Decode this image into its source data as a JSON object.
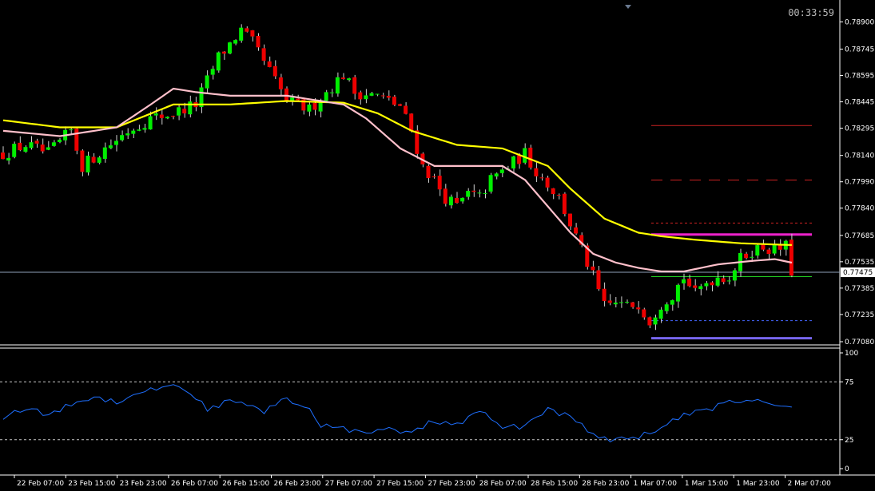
{
  "timer": "00:33:59",
  "colors": {
    "background": "#000000",
    "bull": "#00ee00",
    "bear": "#ee0000",
    "ema_slow": "#ffff00",
    "ema_fast": "#ffc0cb",
    "rsi": "#1e6fff",
    "axis": "#ffffff"
  },
  "chart_data": [
    {
      "type": "candlestick",
      "ylim": [
        0.7708,
        0.7897
      ],
      "y_ticks": [
        "0.78900",
        "0.78745",
        "0.78595",
        "0.78445",
        "0.78295",
        "0.78140",
        "0.77990",
        "0.77840",
        "0.77685",
        "0.77535",
        "0.77385",
        "0.77235",
        "0.77080"
      ],
      "current_price": "0.77475",
      "x_labels": [
        "22 Feb 07:00",
        "23 Feb 15:00",
        "23 Feb 23:00",
        "26 Feb 07:00",
        "26 Feb 15:00",
        "26 Feb 23:00",
        "27 Feb 07:00",
        "27 Feb 15:00",
        "27 Feb 23:00",
        "28 Feb 07:00",
        "28 Feb 15:00",
        "28 Feb 23:00",
        "1 Mar 07:00",
        "1 Mar 15:00",
        "1 Mar 23:00",
        "2 Mar 07:00"
      ],
      "series": [
        {
          "kind": "ohlc",
          "anchors": [
            [
              0,
              0.7815
            ],
            [
              4,
              0.782
            ],
            [
              8,
              0.7815
            ],
            [
              12,
              0.7828
            ],
            [
              14,
              0.7808
            ],
            [
              18,
              0.7818
            ],
            [
              22,
              0.7828
            ],
            [
              26,
              0.7835
            ],
            [
              30,
              0.7838
            ],
            [
              34,
              0.7843
            ],
            [
              38,
              0.787
            ],
            [
              42,
              0.7885
            ],
            [
              44,
              0.7878
            ],
            [
              47,
              0.7862
            ],
            [
              50,
              0.7845
            ],
            [
              54,
              0.784
            ],
            [
              57,
              0.785
            ],
            [
              60,
              0.786
            ],
            [
              62,
              0.785
            ],
            [
              66,
              0.7848
            ],
            [
              70,
              0.7842
            ],
            [
              72,
              0.7828
            ],
            [
              74,
              0.7808
            ],
            [
              76,
              0.78
            ],
            [
              78,
              0.779
            ],
            [
              80,
              0.7785
            ],
            [
              82,
              0.7792
            ],
            [
              84,
              0.779
            ],
            [
              86,
              0.78
            ],
            [
              90,
              0.781
            ],
            [
              92,
              0.7815
            ],
            [
              94,
              0.7805
            ],
            [
              96,
              0.7798
            ],
            [
              98,
              0.779
            ],
            [
              100,
              0.7775
            ],
            [
              102,
              0.776
            ],
            [
              104,
              0.7745
            ],
            [
              106,
              0.7728
            ],
            [
              108,
              0.773
            ],
            [
              110,
              0.7728
            ],
            [
              112,
              0.773
            ],
            [
              114,
              0.772
            ],
            [
              116,
              0.773
            ],
            [
              118,
              0.7735
            ],
            [
              120,
              0.7745
            ],
            [
              122,
              0.7735
            ],
            [
              124,
              0.7742
            ],
            [
              126,
              0.7745
            ],
            [
              128,
              0.7745
            ],
            [
              130,
              0.7755
            ],
            [
              132,
              0.776
            ],
            [
              134,
              0.7762
            ],
            [
              136,
              0.776
            ],
            [
              138,
              0.7762
            ],
            [
              139,
              0.7748
            ]
          ]
        },
        {
          "name": "",
          "kind": "ma",
          "anchors": [
            [
              0,
              0.7834
            ],
            [
              10,
              0.783
            ],
            [
              20,
              0.783
            ],
            [
              30,
              0.7843
            ],
            [
              40,
              0.7843
            ],
            [
              50,
              0.7845
            ],
            [
              60,
              0.7844
            ],
            [
              66,
              0.7838
            ],
            [
              72,
              0.7828
            ],
            [
              80,
              0.782
            ],
            [
              88,
              0.7818
            ],
            [
              96,
              0.7808
            ],
            [
              100,
              0.7795
            ],
            [
              106,
              0.7778
            ],
            [
              112,
              0.777
            ],
            [
              116,
              0.7768
            ],
            [
              122,
              0.7766
            ],
            [
              130,
              0.7764
            ],
            [
              139,
              0.7763
            ]
          ]
        },
        {
          "name": "",
          "kind": "ma",
          "anchors": [
            [
              0,
              0.7828
            ],
            [
              10,
              0.7825
            ],
            [
              20,
              0.783
            ],
            [
              26,
              0.7843
            ],
            [
              30,
              0.7852
            ],
            [
              34,
              0.785
            ],
            [
              40,
              0.7848
            ],
            [
              50,
              0.7848
            ],
            [
              60,
              0.7843
            ],
            [
              64,
              0.7835
            ],
            [
              70,
              0.7818
            ],
            [
              76,
              0.7808
            ],
            [
              82,
              0.7808
            ],
            [
              88,
              0.7808
            ],
            [
              92,
              0.78
            ],
            [
              96,
              0.7785
            ],
            [
              100,
              0.777
            ],
            [
              104,
              0.7758
            ],
            [
              108,
              0.7753
            ],
            [
              112,
              0.775
            ],
            [
              116,
              0.7748
            ],
            [
              120,
              0.7748
            ],
            [
              126,
              0.7752
            ],
            [
              132,
              0.7754
            ],
            [
              136,
              0.7755
            ],
            [
              139,
              0.7753
            ]
          ]
        }
      ],
      "levels": [
        {
          "value": 0.7831,
          "color": "#cc2222",
          "style": "solid"
        },
        {
          "value": 0.78,
          "color": "#cc2222",
          "style": "dashed"
        },
        {
          "value": 0.77755,
          "color": "#cc2222",
          "style": "dotted"
        },
        {
          "value": 0.7769,
          "color": "#ee22cc",
          "style": "solid-thick"
        },
        {
          "value": 0.7745,
          "color": "#22cc22",
          "style": "solid"
        },
        {
          "value": 0.772,
          "color": "#4466ff",
          "style": "dotted"
        },
        {
          "value": 0.771,
          "color": "#7766ee",
          "style": "solid-thick"
        }
      ]
    },
    {
      "type": "line",
      "ylim": [
        0,
        100
      ],
      "y_ticks": [
        "100",
        "75",
        "25",
        "0"
      ],
      "levels": [
        75,
        25
      ],
      "anchors": [
        [
          0,
          45
        ],
        [
          4,
          52
        ],
        [
          8,
          46
        ],
        [
          12,
          56
        ],
        [
          16,
          62
        ],
        [
          20,
          58
        ],
        [
          24,
          66
        ],
        [
          28,
          70
        ],
        [
          30,
          73
        ],
        [
          32,
          69
        ],
        [
          36,
          52
        ],
        [
          40,
          58
        ],
        [
          46,
          50
        ],
        [
          50,
          60
        ],
        [
          54,
          50
        ],
        [
          56,
          38
        ],
        [
          60,
          35
        ],
        [
          64,
          30
        ],
        [
          68,
          34
        ],
        [
          72,
          30
        ],
        [
          76,
          42
        ],
        [
          80,
          37
        ],
        [
          84,
          50
        ],
        [
          88,
          35
        ],
        [
          92,
          37
        ],
        [
          96,
          52
        ],
        [
          100,
          44
        ],
        [
          104,
          30
        ],
        [
          108,
          24
        ],
        [
          112,
          28
        ],
        [
          116,
          35
        ],
        [
          120,
          46
        ],
        [
          124,
          50
        ],
        [
          128,
          58
        ],
        [
          132,
          60
        ],
        [
          136,
          56
        ],
        [
          139,
          52
        ]
      ]
    }
  ]
}
